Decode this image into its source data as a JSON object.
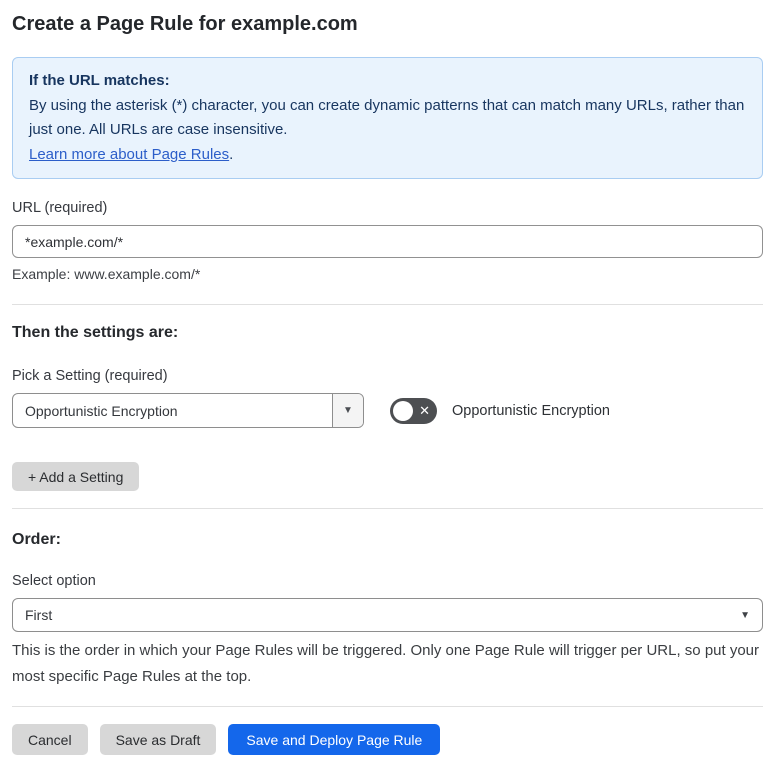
{
  "page": {
    "title": "Create a Page Rule for example.com"
  },
  "info_box": {
    "heading": "If the URL matches:",
    "body": "By using the asterisk (*) character, you can create dynamic patterns that can match many URLs, rather than just one. All URLs are case insensitive.",
    "link": "Learn more about Page Rules",
    "link_suffix": "."
  },
  "url_field": {
    "label": "URL (required)",
    "value": "*example.com/*",
    "example": "Example: www.example.com/*"
  },
  "settings_section": {
    "heading": "Then the settings are:",
    "setting_label": "Pick a Setting (required)",
    "setting_value": "Opportunistic Encryption",
    "toggle_label": "Opportunistic Encryption",
    "toggle_state": "off",
    "add_button_label": "+ Add a Setting"
  },
  "order_section": {
    "heading": "Order:",
    "label": "Select option",
    "value": "First",
    "help": "This is the order in which your Page Rules will be triggered. Only one Page Rule will trigger per URL, so put your most specific Page Rules at the top."
  },
  "footer": {
    "cancel_label": "Cancel",
    "save_draft_label": "Save as Draft",
    "save_deploy_label": "Save and Deploy Page Rule"
  },
  "icons": {
    "dropdown_arrow": "▼",
    "toggle_off_x": "✕"
  },
  "colors": {
    "accent_blue": "#1467eb",
    "info_bg": "#e9f3fd",
    "info_border": "#a9cdf2",
    "info_text": "#17355f",
    "link_blue": "#2c5ec9",
    "toggle_off_bg": "#4d4f52",
    "button_gray": "#d7d7d7"
  }
}
